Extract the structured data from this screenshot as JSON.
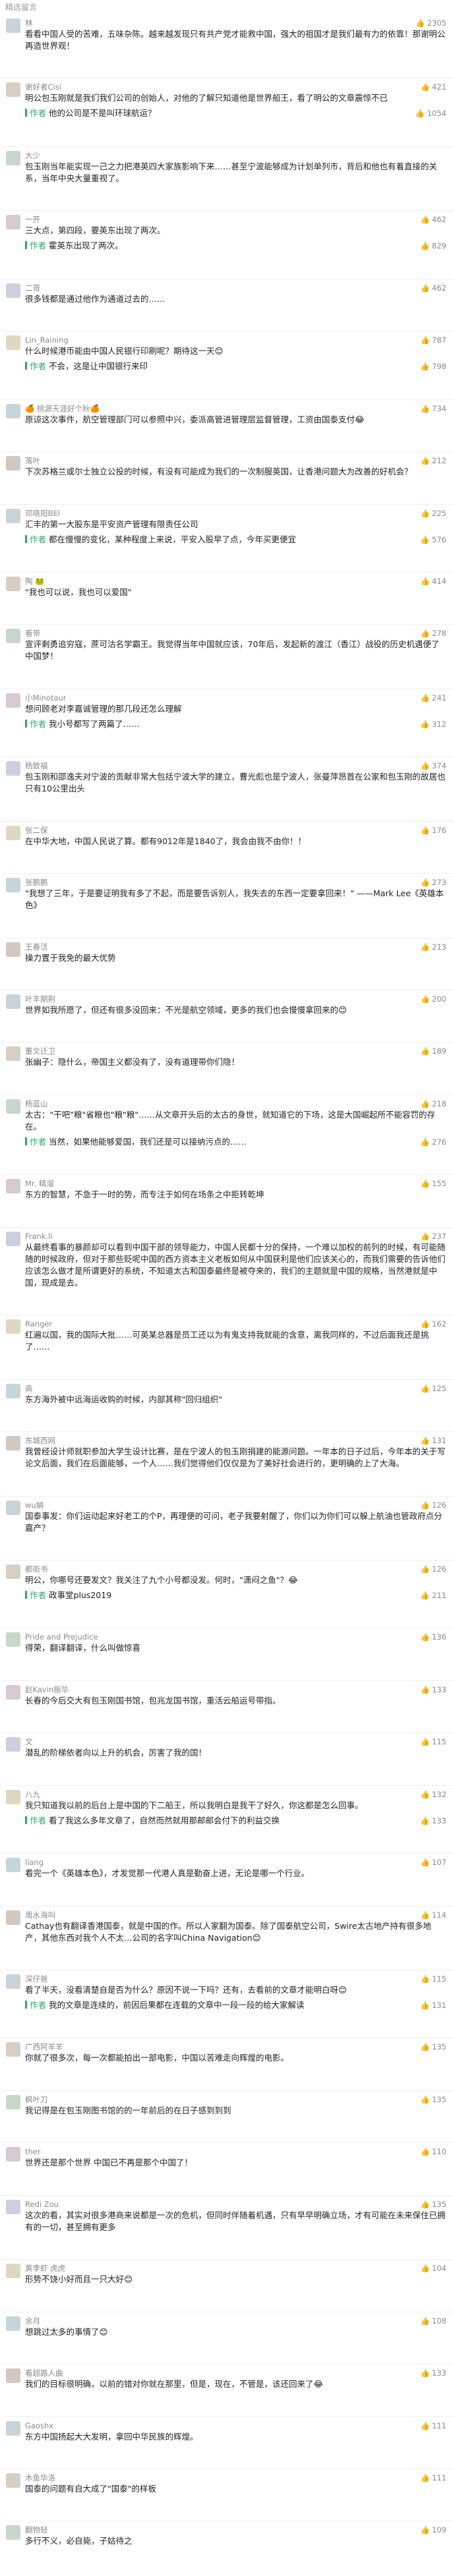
{
  "header": {
    "title": "精选留言"
  },
  "icons": {
    "like": "thumbs-up-icon"
  },
  "comments": [
    {
      "name": "林",
      "likes": "2305",
      "text": "看看中国人受的苦难，五味杂陈。越来越发现只有共产党才能救中国，强大的祖国才是我们最有力的依靠！那谢明公再造世界观！",
      "reply": null
    },
    {
      "name": "谢好者Cisi",
      "likes": "421",
      "text": "明公包玉刚就是我们我们公司的创始人，对他的了解只知道他是世界船王，看了明公的文章震惊不已",
      "reply": {
        "author": "作者",
        "text": "他的公司是不是叫环球航运？",
        "likes": "1054"
      }
    },
    {
      "name": "大少",
      "likes": "",
      "text": "包玉刚当年能实现一己之力把港英四大家族影响下来……甚至宁波能够成为计划单列市，背后和他也有着直接的关系，当年中央大量重视了。",
      "reply": null
    },
    {
      "name": "一开",
      "likes": "462",
      "text": "三大点，第四段，要英东出现了两次。",
      "reply": {
        "author": "作者",
        "text": "霍英东出现了两次。",
        "likes": "829"
      }
    },
    {
      "name": "二哥",
      "likes": "462",
      "text": "很多钱都是通过他作为通道过去的……",
      "reply": null
    },
    {
      "name": "Lin_Raining",
      "likes": "787",
      "text": "什么时候港币能由中国人民银行印刷呢？期待这一天😊",
      "reply": {
        "author": "作者",
        "text": "不会，这是让中国银行来印",
        "likes": "798"
      }
    },
    {
      "name": "🍊 桃源天涯好个秋🍊",
      "likes": "734",
      "text": "原谅这次事件，航空管理部门可以参照中兴，委派高管进管理层监督管理，工资由国泰支付😂",
      "reply": null
    },
    {
      "name": "落叶",
      "likes": "212",
      "text": "下次苏格兰或尔士独立公投的时候，有没有可能成为我们的一次制服英国，让香港问题大为改善的好机会？",
      "reply": null
    },
    {
      "name": "邓晓阳BEI",
      "likes": "225",
      "text": "汇丰的第一大股东是平安资产管理有限责任公司",
      "reply": {
        "author": "作者",
        "text": "都在慢慢的变化，某种程度上来说，平安入股早了点，今年买更便宜",
        "likes": "576"
      }
    },
    {
      "name": "陶 🐸",
      "likes": "414",
      "text": "\"我也可以说，我也可以爱国\"",
      "reply": null
    },
    {
      "name": "看带",
      "likes": "278",
      "text": "宣评剩勇追穷寇，蔗可沽名学霸王。我觉得当年中国就应该，70年后，发起新的渡江（香江）战役的历史机遇便了中国梦！",
      "reply": null
    },
    {
      "name": "小Minotaur",
      "likes": "241",
      "text": "想问顾老对李嘉诚管理的那几段还怎么理解",
      "reply": {
        "author": "作者",
        "text": "我小号都写了两篇了……",
        "likes": "312"
      }
    },
    {
      "name": "杨致福",
      "likes": "374",
      "text": "包玉刚和邵逸夫对宁波的贡献非常大包括宁波大学的建立，曹光彪也是宁波人，张曼萍昂首在公家和包玉刚的故居也只有10公里出头",
      "reply": null
    },
    {
      "name": "张二保",
      "likes": "176",
      "text": "在中华大地，中国人民说了算。都有9012年是1840了，我会由我不由你！！",
      "reply": null
    },
    {
      "name": "张鹏鹏",
      "likes": "273",
      "text": "\"我想了三年，于是要证明我有多了不起，而是要告诉别人，我失去的东西一定要拿回来！\" ——Mark Lee《英雄本色》",
      "reply": null
    },
    {
      "name": "王春活",
      "likes": "213",
      "text": "操力置于我免的最大优势",
      "reply": null
    },
    {
      "name": "叶丰期荆",
      "likes": "200",
      "text": "世界如我所愿了，但还有很多没回来：不光是航空领域，更多的我们也会慢慢拿回来的😊",
      "reply": null
    },
    {
      "name": "董文迁卫",
      "likes": "189",
      "text": "张幽子：隐什么，帝国主义都没有了，没有道理带你们隐！",
      "reply": null
    },
    {
      "name": "杨蓝山",
      "likes": "218",
      "text": "太古：\"干吧\"粮\"省粮也\"粮\"粮\"……从文章开头后的太古的身世，就知道它的下场，这是大国崛起所不能容罚的存在。",
      "reply": {
        "author": "作者",
        "text": "当然，如果他能够爱国，我们还是可以接纳污点的……",
        "likes": "276"
      }
    },
    {
      "name": "Mr. 精溜",
      "likes": "155",
      "text": "东方的智慧，不急于一时的势，而专注于如何在场条之中拒转乾坤",
      "reply": null
    },
    {
      "name": "Frank.li",
      "likes": "237",
      "text": "从最终看事的暴颜却可以看到中国干部的领导能力，中国人民都十分的保持，一个难以加权的前列的时候，有可能随随的时候政府，但对于那些贬呢中国的西方资本主义老板如何从中国获利是他们应该关心的，而我们需要的告诉他们应该怎么做才是所谓更好的系统，不知道太古和国泰最终是被夺来的，我们的主题就是中国的规格，当然港就是中国，现成是去。",
      "reply": null
    },
    {
      "name": "Ranger",
      "likes": "162",
      "text": "红遍以国，我的国际大批……可英某总器是员工还以为有鬼支持我就能的含意，离我同样的，不过后面我还是挑了……",
      "reply": null
    },
    {
      "name": "高",
      "likes": "125",
      "text": "东方海外被中远海运收购的时候，内部其称\"回归组织\"",
      "reply": null
    },
    {
      "name": "东城西网",
      "likes": "131",
      "text": "我曾经设计师就职参加大学生设计比赛，是在宁波人的包玉刚捐建的能源问题。一年本的日子过后，今年本的关于写论文后面，我们在后面能够，一个人……我们觉得他们仅仅是为了美好社会进行的，更明确的上了大海。",
      "reply": null
    },
    {
      "name": "wu娟",
      "likes": "126",
      "text": "国泰事发：你们运动起来好老工的个P，再理便的可问，老子我要射醒了，你们以为你们可以躲上航油也管政府点分嘉产？",
      "reply": null
    },
    {
      "name": "都街书",
      "likes": "126",
      "text": "明公，你哪号还要发文？我关注了九个小号都没发。何时，\"潇闷之鱼\"？😂",
      "reply": {
        "author": "作者",
        "text": "政事堂plus2019",
        "likes": "211"
      }
    },
    {
      "name": "Pride and Prejudice",
      "likes": "136",
      "text": "得荣，翻译翻译，什么叫做惊喜",
      "reply": null
    },
    {
      "name": "赵Kavin振华",
      "likes": "133",
      "text": "长春的今后交大有包玉刚国书馆，包兆龙国书馆，重活云船运号带指。",
      "reply": null
    },
    {
      "name": "文",
      "likes": "115",
      "text": "潜乱的阶梯依者向以上升的机会，厉害了我的国！",
      "reply": null
    },
    {
      "name": "八九",
      "likes": "132",
      "text": "我只知道我以前的后台上是中国的下二船王，所以我明白是我干了好久，你这都是怎么回事。",
      "reply": {
        "author": "作者",
        "text": "看了我这么多年文章了，自然而然就用那邮邮会付下的利益交换",
        "likes": "133"
      }
    },
    {
      "name": "liang",
      "likes": "107",
      "text": "看完一个《英雄本色》，才发觉那一代港人真是勤奋上进，无论是哪一个行业。",
      "reply": null
    },
    {
      "name": "周水海叫",
      "likes": "114",
      "text": "Cathay也有翻译香港国泰，就是中国的作。所以人家翻为国泰。除了国泰航空公司，Swire太古地产持有很多地产，其他东西对我个人不太…公司的名字叫China Navigation😊",
      "reply": null
    },
    {
      "name": "深仔爸",
      "likes": "115",
      "text": "看了半天，没看清楚自是否为什么？原因不说一下吗？还有，去看前的文章才能明白呀😊",
      "reply": {
        "author": "作者",
        "text": "我的文章是连续的，前因后果都在连载的文章中一段一段的给大家解读",
        "likes": "131"
      }
    },
    {
      "name": "广西阿羊羊",
      "likes": "135",
      "text": "你就了很多次，每一次都能拍出一部电影，中国以苦难走向辉煌的电影。",
      "reply": null
    },
    {
      "name": "枫叶刀",
      "likes": "135",
      "text": "我记得是在包玉刚图书馆的的一年前后的在日子感到到到",
      "reply": null
    },
    {
      "name": "ther",
      "likes": "110",
      "text": "世界还是那个世界 中国已不再是那个中国了！",
      "reply": null
    },
    {
      "name": "Redi Zou",
      "likes": "135",
      "text": "这次的看，其实对很多港商来说都是一次的危机，但同时伴随着机遇，只有早早明确立场，才有可能在未来保住已拥有的一切，甚至拥有更多",
      "reply": null
    },
    {
      "name": "黄李虾 虎虎",
      "likes": "104",
      "text": "形势不饶小好而且一只大好😊",
      "reply": null
    },
    {
      "name": "余月",
      "likes": "108",
      "text": "想跳过太多的事情了😊",
      "reply": null
    },
    {
      "name": "看超路人曲",
      "likes": "133",
      "text": "我们的目标很明确，以前的错对你就在那里，但是，现在，不管是，该还回来了😂",
      "reply": null
    },
    {
      "name": "Gaoshx",
      "likes": "111",
      "text": "东方中国扬起大大发明，拿回中华民族的辉煌。",
      "reply": null
    },
    {
      "name": "木鱼华洛",
      "likes": "111",
      "text": "国泰的问题有自大成了\"国泰\"的样板",
      "reply": null
    },
    {
      "name": "翻物轻",
      "likes": "109",
      "text": "多行不义，必自毙，子姑待之",
      "reply": null
    }
  ]
}
